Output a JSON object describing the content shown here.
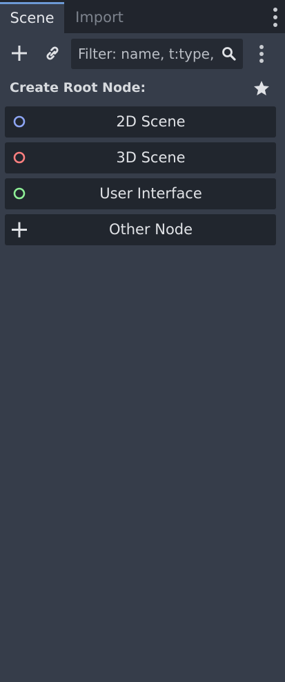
{
  "tabs": [
    {
      "label": "Scene",
      "active": true
    },
    {
      "label": "Import",
      "active": false
    }
  ],
  "toolbar": {
    "add_icon": "plus-icon",
    "link_icon": "link-icon",
    "filter_placeholder": "Filter: name, t:type, g:group",
    "search_icon": "search-icon",
    "menu_icon": "kebab-menu-icon"
  },
  "section": {
    "title": "Create Root Node:",
    "favorite_icon": "star-icon"
  },
  "root_buttons": [
    {
      "label": "2D Scene",
      "icon": "circle-outline-icon",
      "color": "#8da5f3"
    },
    {
      "label": "3D Scene",
      "icon": "circle-outline-icon",
      "color": "#fc7f7f"
    },
    {
      "label": "User Interface",
      "icon": "circle-outline-icon",
      "color": "#8eef97"
    },
    {
      "label": "Other Node",
      "icon": "plus-icon",
      "color": "#e0e2e6"
    }
  ],
  "colors": {
    "accent": "#6d9ad6",
    "panel": "#363d4a",
    "button": "#21262e"
  }
}
